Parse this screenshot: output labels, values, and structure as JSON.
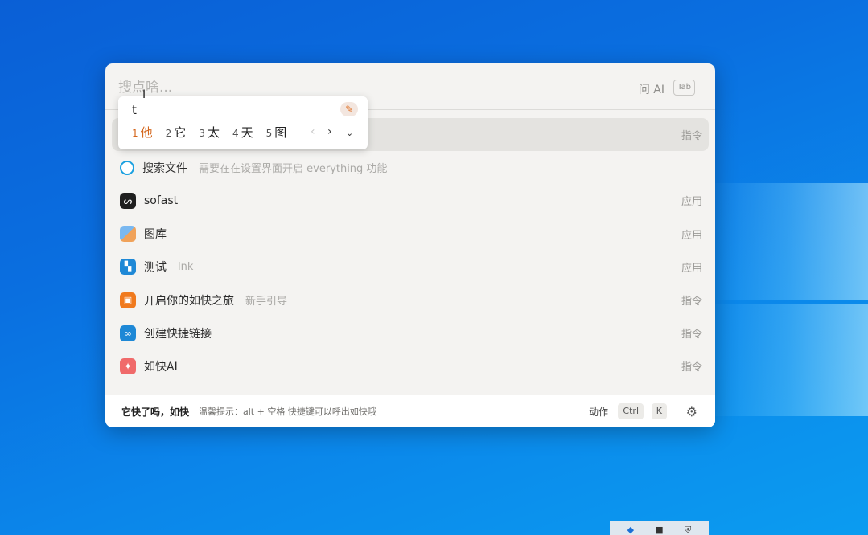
{
  "desktop": {
    "bg_color": "#0b78e3"
  },
  "launcher": {
    "search": {
      "placeholder": "搜点啥...",
      "ask_ai": "问 AI",
      "tab_key": "Tab"
    },
    "results": [
      {
        "icon": "command-icon",
        "icon_glyph": "",
        "icon_color": "#8a8987",
        "title": "",
        "subtitle": "",
        "type": "指令",
        "active": true
      },
      {
        "icon": "search-icon",
        "icon_glyph": "⌕",
        "icon_color": "#1aa0e0",
        "title": "搜索文件",
        "subtitle": "需要在在设置界面开启 everything 功能",
        "type": ""
      },
      {
        "icon": "sofast-logo-icon",
        "icon_glyph": "S",
        "icon_color": "#1f1f1f",
        "title": "sofast",
        "subtitle": "",
        "type": "应用"
      },
      {
        "icon": "gallery-icon",
        "icon_glyph": "▦",
        "icon_color": "#4a8fd8",
        "title": "图库",
        "subtitle": "",
        "type": "应用"
      },
      {
        "icon": "grid-app-icon",
        "icon_glyph": "▚",
        "icon_color": "#1e88d6",
        "title": "测试",
        "subtitle": "lnk",
        "type": "应用"
      },
      {
        "icon": "guide-icon",
        "icon_glyph": "▣",
        "icon_color": "#f07a1e",
        "title": "开启你的如快之旅",
        "subtitle": "新手引导",
        "type": "指令"
      },
      {
        "icon": "link-icon",
        "icon_glyph": "∞",
        "icon_color": "#1e88d6",
        "title": "创建快捷链接",
        "subtitle": "",
        "type": "指令"
      },
      {
        "icon": "sparkle-icon",
        "icon_glyph": "✦",
        "icon_color": "#f06a6a",
        "title": "如快AI",
        "subtitle": "",
        "type": "指令"
      }
    ],
    "footer": {
      "brand": "它快了吗，如快",
      "tip": "温馨提示：alt + 空格 快捷键可以呼出如快哦",
      "action_label": "动作",
      "key_ctrl": "Ctrl",
      "key_k": "K"
    }
  },
  "ime": {
    "composition": "t",
    "candidates": [
      {
        "num": "1",
        "text": "他"
      },
      {
        "num": "2",
        "text": "它"
      },
      {
        "num": "3",
        "text": "太"
      },
      {
        "num": "4",
        "text": "天"
      },
      {
        "num": "5",
        "text": "图"
      }
    ]
  }
}
